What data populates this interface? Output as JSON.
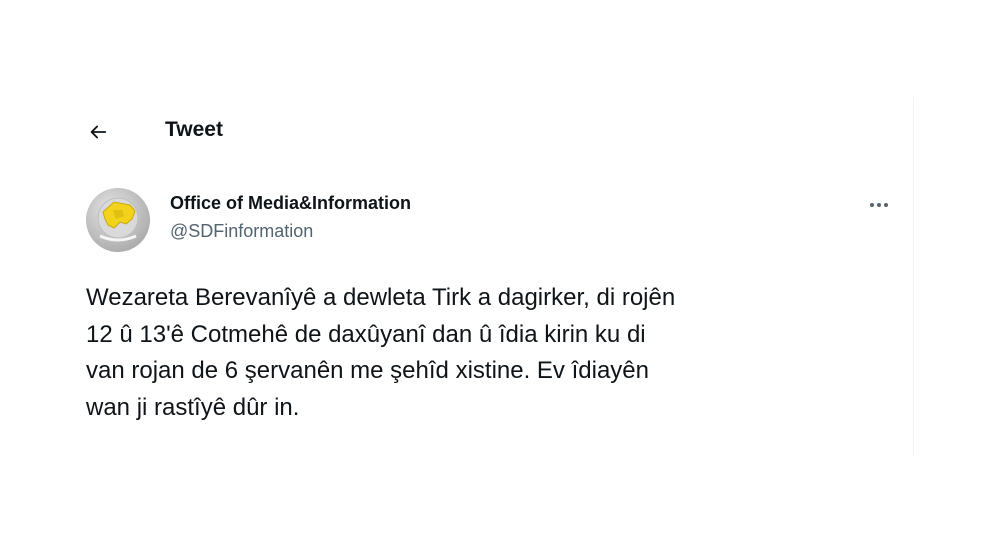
{
  "header": {
    "title": "Tweet",
    "back_icon": "arrow-left-icon"
  },
  "tweet": {
    "author": {
      "name": "Office of Media&Information",
      "handle": "@SDFinformation",
      "avatar_icon": "sdf-logo-icon"
    },
    "more_icon": "more-dots-icon",
    "text": "Wezareta Berevanîyê a dewleta Tirk a dagirker, di rojên\n12 û 13'ê Cotmehê de daxûyanî dan û îdia kirin ku di\nvan rojan de 6 şervanên me şehîd xistine. Ev îdiayên\nwan ji rastîyê dûr in."
  },
  "colors": {
    "text_primary": "#0f1419",
    "text_secondary": "#536471",
    "divider": "#eff3f4",
    "logo_yellow": "#f2d21b",
    "avatar_bg": "#c8c8c8"
  }
}
